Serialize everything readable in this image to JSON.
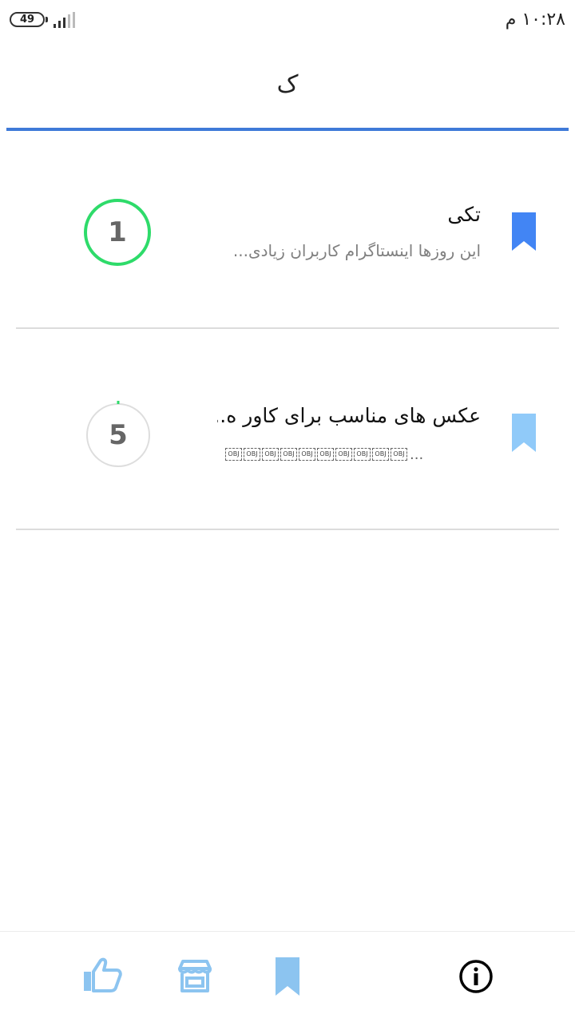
{
  "status_bar": {
    "battery_level": "49",
    "time": "۱۰:۲۸ م"
  },
  "header": {
    "title": "ک"
  },
  "colors": {
    "accent": "#3f7ad8",
    "bookmark_active": "#4285f4",
    "bookmark_inactive": "#90caf9",
    "progress_green": "#2edb6a",
    "ring_gray": "#dddddd",
    "nav_icon": "#8cc4f0"
  },
  "items": [
    {
      "title": "تکی",
      "subtitle": "این روزها اینستاگرام کاربران زیادی...",
      "count": "1",
      "progress": 1.0,
      "bookmarked": true
    },
    {
      "title": "عکس های مناسب برای کاور ه...",
      "subtitle_placeholders": [
        "OBJ",
        "OBJ",
        "OBJ",
        "OBJ",
        "OBJ",
        "OBJ",
        "OBJ",
        "OBJ",
        "OBJ",
        "OBJ"
      ],
      "subtitle_ellipsis": "...",
      "count": "5",
      "progress": 0.0,
      "bookmarked": false
    }
  ],
  "bottom_nav": [
    {
      "icon": "thumbs-up-icon"
    },
    {
      "icon": "store-icon"
    },
    {
      "icon": "bookmark-icon"
    },
    {
      "icon": "info-icon"
    }
  ]
}
